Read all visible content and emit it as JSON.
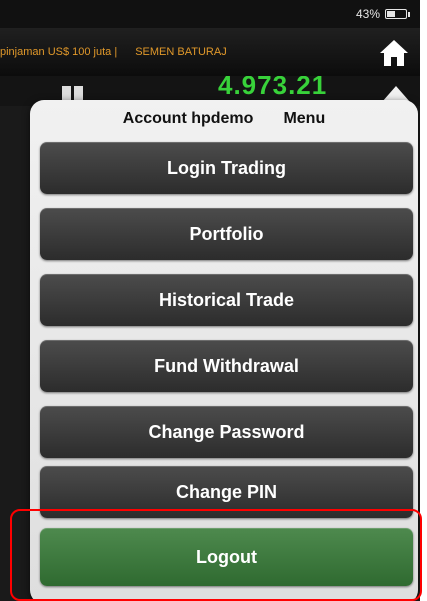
{
  "status_bar": {
    "battery_percent": "43%",
    "battery_level": 0.43
  },
  "ticker": {
    "items": [
      "pinjaman US$ 100 juta |",
      "SEMEN BATURAJ"
    ]
  },
  "market": {
    "index_value": "4.973.21"
  },
  "popover": {
    "header_account": "Account hpdemo",
    "header_menu": "Menu",
    "buttons": [
      {
        "label": "Login Trading"
      },
      {
        "label": "Portfolio"
      },
      {
        "label": "Historical Trade"
      },
      {
        "label": "Fund Withdrawal"
      },
      {
        "label": "Change Password"
      },
      {
        "label": "Change PIN"
      },
      {
        "label": "Logout"
      }
    ]
  },
  "colors": {
    "ticker_text": "#e0982a",
    "index_green": "#38d23a",
    "logout_green": "#2f6a30",
    "highlight_red": "#ff0000"
  }
}
